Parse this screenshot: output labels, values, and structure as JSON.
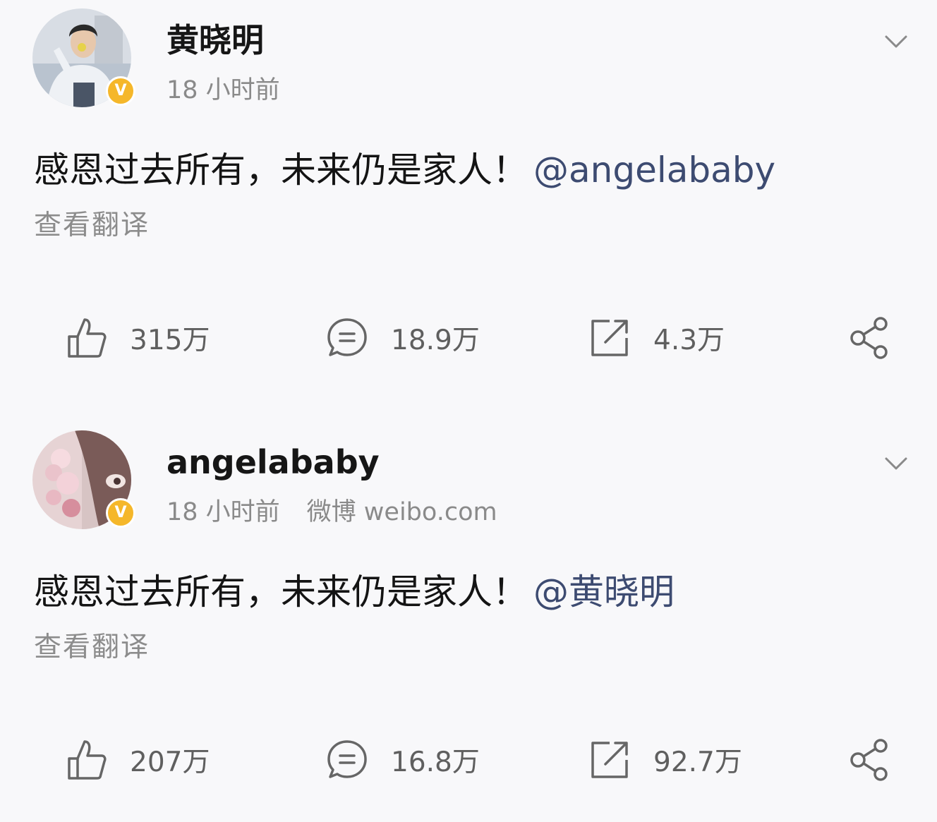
{
  "posts": [
    {
      "username": "黄晓明",
      "time": "18 小时前",
      "source": "",
      "content_text": "感恩过去所有，未来仍是家人！",
      "mention": "@angelababy",
      "translate_label": "查看翻译",
      "verified_badge": "V",
      "actions": {
        "likes": "315万",
        "comments": "18.9万",
        "reposts": "4.3万"
      }
    },
    {
      "username": "angelababy",
      "time": "18 小时前",
      "source": "微博 weibo.com",
      "content_text": "感恩过去所有，未来仍是家人！",
      "mention": "@黄晓明",
      "translate_label": "查看翻译",
      "verified_badge": "V",
      "actions": {
        "likes": "207万",
        "comments": "16.8万",
        "reposts": "92.7万"
      }
    }
  ],
  "icons": [
    "like-icon",
    "comment-icon",
    "repost-icon",
    "share-icon",
    "chevron-down-icon",
    "verified-badge-icon"
  ],
  "colors": {
    "background": "#f8f8fa",
    "mention": "#3d4b71",
    "verified_badge": "#f5b72a",
    "meta_text": "#8a8a8a"
  }
}
